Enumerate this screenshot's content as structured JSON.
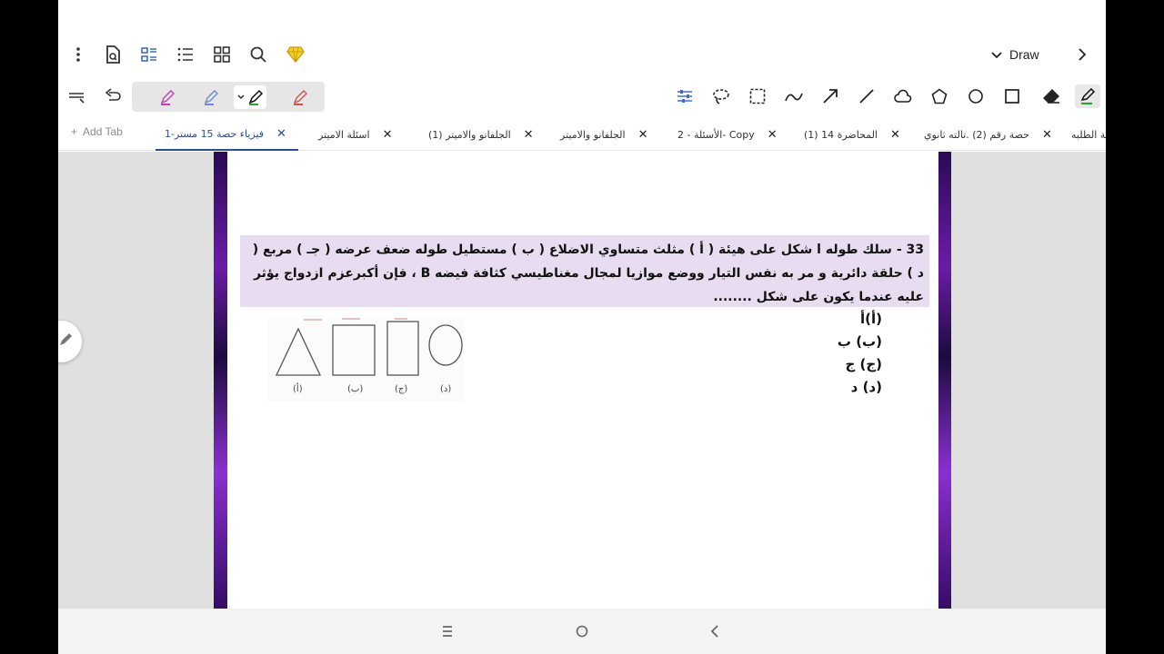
{
  "top_bar": {
    "draw_mode_label": "Draw",
    "icons": [
      "more-vert-icon",
      "document-search-icon",
      "page-layout-icon",
      "list-icon",
      "grid-icon",
      "search-icon",
      "premium-diamond-icon",
      "chevron-right-icon"
    ]
  },
  "toolbar": {
    "pen_colors": [
      "#c23fb6",
      "#6e86d8",
      "#2e9e3f",
      "#d4504f"
    ],
    "selected_pen": 2,
    "tools": [
      "adjust-icon",
      "lasso-icon",
      "select-rect-icon",
      "line-wave-icon",
      "arrow-icon",
      "line-icon",
      "cloud-icon",
      "pentagon-icon",
      "circle-icon",
      "rectangle-icon",
      "eraser-icon",
      "highlighter-icon"
    ]
  },
  "tabs": {
    "add_label": "Add Tab",
    "items": [
      {
        "label": "فيزياء حصة 15 مستر-1",
        "active": true
      },
      {
        "label": "اسئلة الاميتر",
        "active": false
      },
      {
        "label": "الجلفانو والاميتر (1)",
        "active": false
      },
      {
        "label": "الجلفانو والاميتر",
        "active": false
      },
      {
        "label": "الأسئلة - 2- Copy",
        "active": false
      },
      {
        "label": "المحاضرة 14 (1)",
        "active": false
      },
      {
        "label": "حصة رقم (2) .تالته ثانوي",
        "active": false
      },
      {
        "label": "حة الطلبه",
        "active": false
      }
    ]
  },
  "document": {
    "question_text": "33 - سلك طوله l شكل على هيئة ( أ ) مثلث متساوي الاضلاع ( ب ) مستطيل طوله ضعف عرضه ( جـ ) مربع ( د ) حلقة دائرية و مر به نفس التيار ووضع موازيا لمجال مغناطيسي كثافة فيضه B ، فإن أكبرعزم ازدواج يؤثر عليه عندما يكون على شكل ........",
    "options": [
      "(أ)أ",
      "(ب) ب",
      "(ج) ج",
      "(د) د"
    ],
    "figure_labels": [
      "(أ)",
      "(ب)",
      "(ج)",
      "(د)"
    ]
  },
  "colors": {
    "accent": "#2b4aa3",
    "question_bg": "#e8dcf0",
    "premium": "#e0b400"
  }
}
